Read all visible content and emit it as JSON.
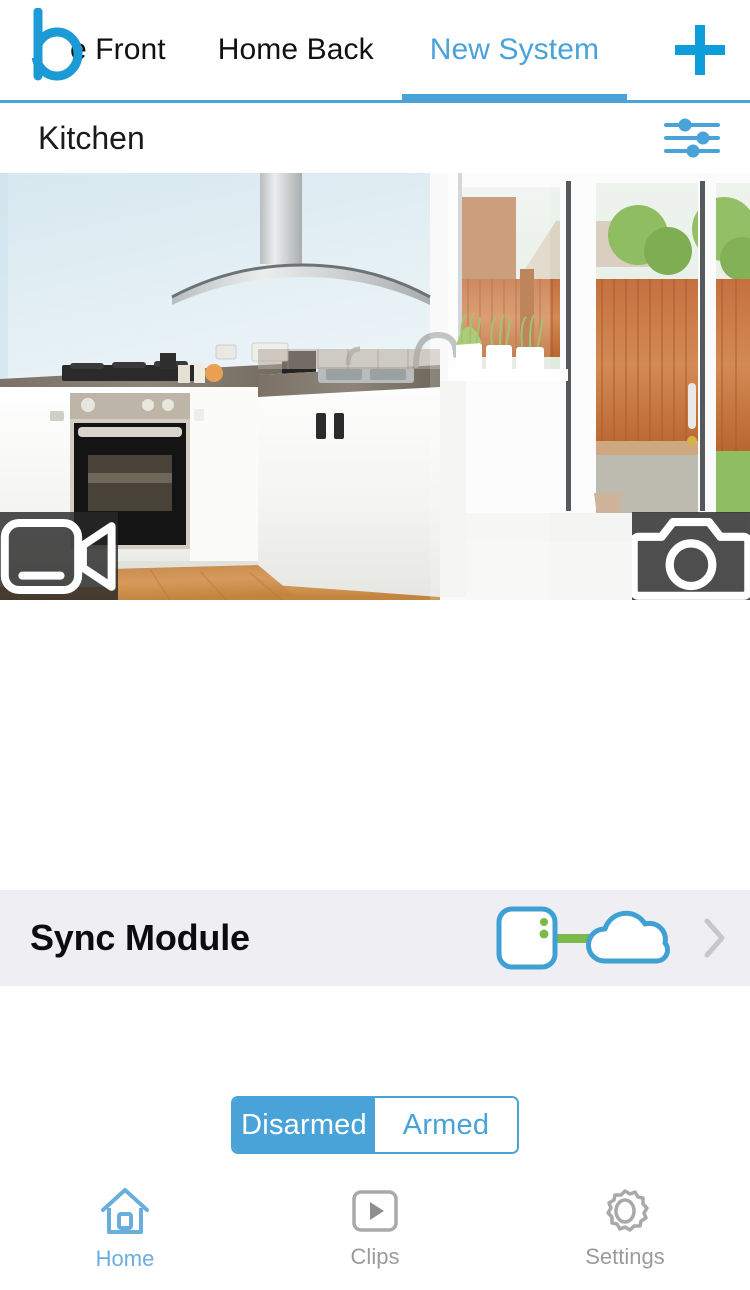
{
  "app": {
    "brand_logo": "blink-b-logo",
    "accent_color": "#4aa3d8",
    "plus_color": "#0d9ddb",
    "sync_band_color": "#eeeef3"
  },
  "tabbar": {
    "tabs": [
      {
        "label": "e Front",
        "active": false,
        "clipped": true
      },
      {
        "label": "Home Back",
        "active": false,
        "clipped": false
      },
      {
        "label": "New System",
        "active": true,
        "clipped": false
      }
    ],
    "add_button": {
      "icon": "plus-icon",
      "label": "+"
    }
  },
  "camera": {
    "title": "Kitchen",
    "settings_icon": "sliders-icon",
    "preview_alt": "kitchen-live-view",
    "controls": [
      {
        "icon": "video-camera-icon",
        "position": "left"
      },
      {
        "icon": "photo-camera-icon",
        "position": "right"
      }
    ]
  },
  "sync_module": {
    "label": "Sync Module",
    "status_icon": "sync-module-cloud-connected-icon",
    "chevron_icon": "chevron-right-icon"
  },
  "arm_toggle": {
    "options": [
      {
        "label": "Disarmed",
        "selected": true
      },
      {
        "label": "Armed",
        "selected": false
      }
    ]
  },
  "bottom_nav": {
    "items": [
      {
        "label": "Home",
        "icon": "home-icon",
        "active": true
      },
      {
        "label": "Clips",
        "icon": "play-square-icon",
        "active": false
      },
      {
        "label": "Settings",
        "icon": "gear-icon",
        "active": false
      }
    ]
  }
}
